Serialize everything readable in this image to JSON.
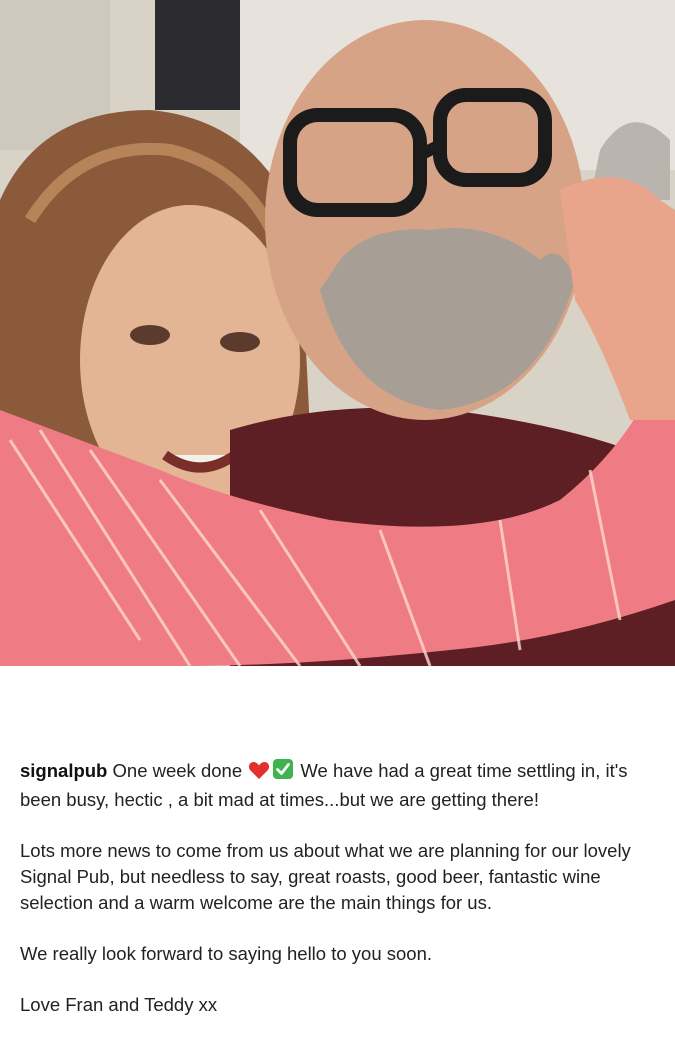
{
  "post": {
    "image_icon": "photo-couple-embracing",
    "caption": {
      "username": "signalpub",
      "line1_text_before": "One week done",
      "emoji_heart": "❤️",
      "emoji_check": "✅",
      "line1_text_after": "We have had a great time settling in, it's been busy, hectic , a bit mad at times...but we are getting there!",
      "paragraph2": "Lots more news to come from us about what we are planning for our lovely Signal Pub, but needless to say, great roasts, good beer, fantastic wine selection and a warm welcome are the main things for us.",
      "paragraph3": "We really look forward to saying hello to you soon.",
      "paragraph4": "Love Fran and Teddy xx"
    }
  },
  "colors": {
    "heart": "#e0312e",
    "check_bg": "#3fb34f",
    "text": "#222222"
  }
}
